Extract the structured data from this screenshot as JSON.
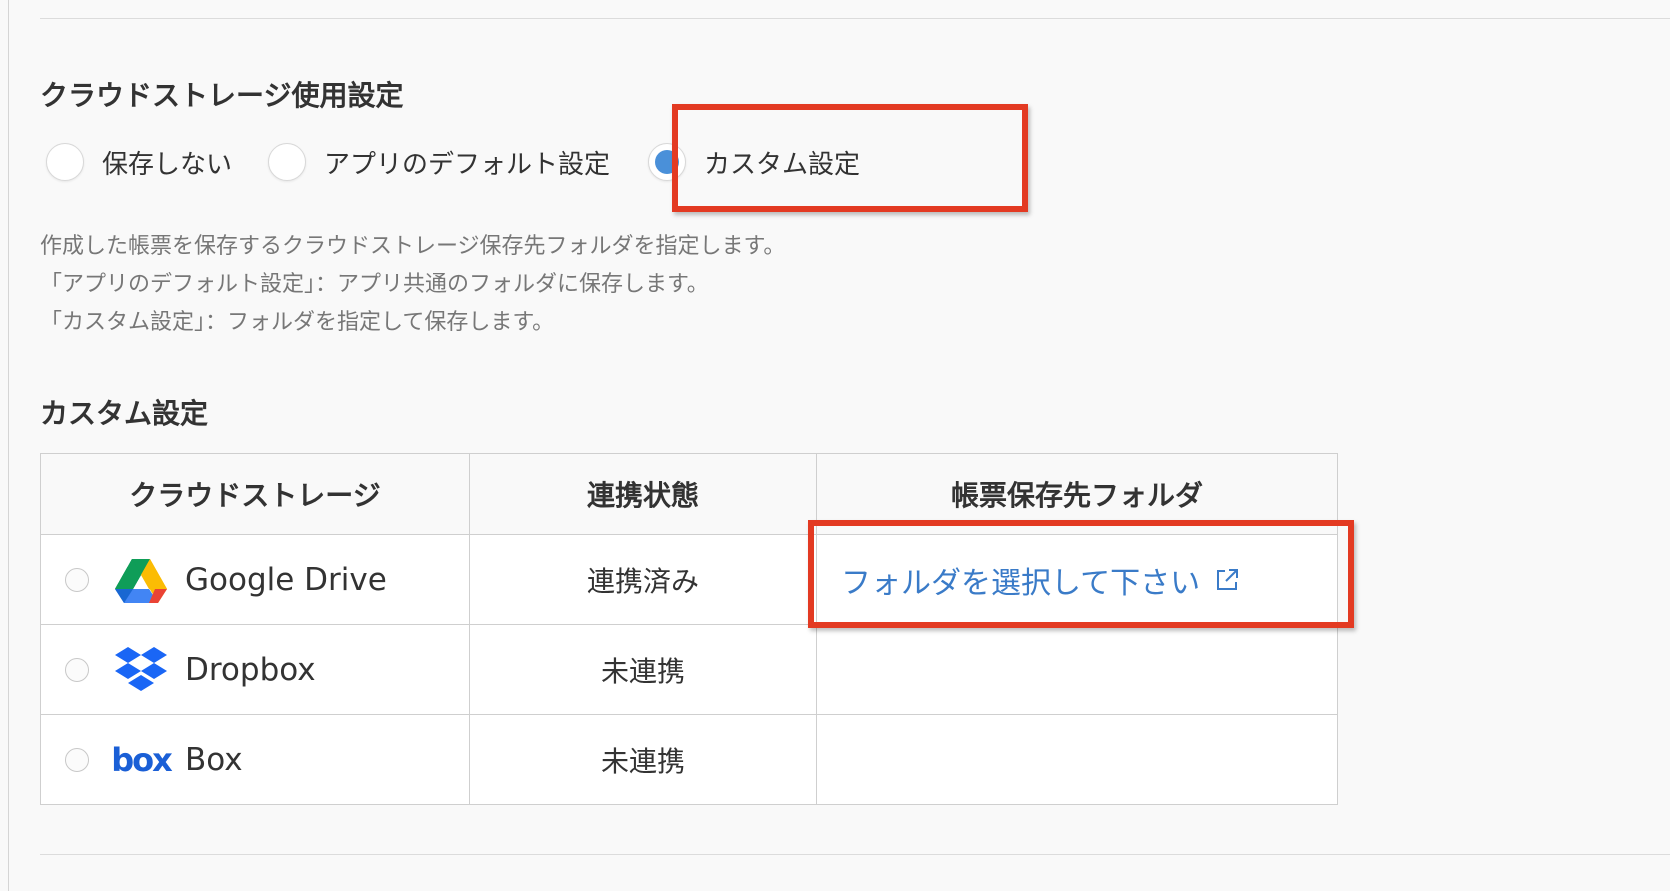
{
  "usage": {
    "title": "クラウドストレージ使用設定",
    "options": [
      {
        "label": "保存しない",
        "checked": false
      },
      {
        "label": "アプリのデフォルト設定",
        "checked": false
      },
      {
        "label": "カスタム設定",
        "checked": true
      }
    ],
    "description": [
      "作成した帳票を保存するクラウドストレージ保存先フォルダを指定します。",
      "「アプリのデフォルト設定」：アプリ共通のフォルダに保存します。",
      "「カスタム設定」：フォルダを指定して保存します。"
    ]
  },
  "custom": {
    "title": "カスタム設定",
    "headers": [
      "クラウドストレージ",
      "連携状態",
      "帳票保存先フォルダ"
    ],
    "rows": [
      {
        "service": "Google Drive",
        "logo": "google-drive-icon",
        "status": "連携済み",
        "folder_link": "フォルダを選択して下さい"
      },
      {
        "service": "Dropbox",
        "logo": "dropbox-icon",
        "status": "未連携",
        "folder_link": ""
      },
      {
        "service": "Box",
        "logo": "box-icon",
        "logo_text": "box",
        "status": "未連携",
        "folder_link": ""
      }
    ]
  },
  "colors": {
    "accent": "#4a90d9",
    "link": "#3a7bc8",
    "highlight": "#e33a22",
    "box_brand": "#1a5fd6",
    "dropbox_brand": "#1a66f5"
  }
}
